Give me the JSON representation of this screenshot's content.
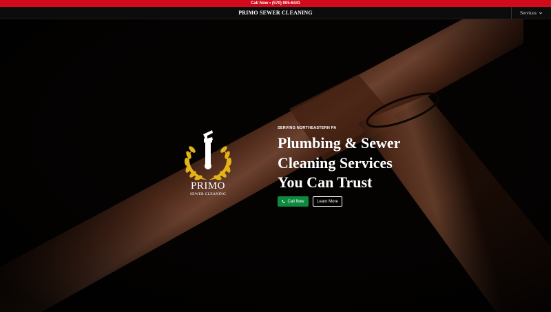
{
  "topbar": {
    "call_label": "Call Now • (570) 905-6441"
  },
  "nav": {
    "brand": "PRIMO SEWER CLEANING",
    "menu_label": "Services"
  },
  "logo": {
    "name": "PRIMO",
    "tagline": "SEWER CLEANING"
  },
  "hero": {
    "eyebrow": "SERVING NORTHEASTERN PA",
    "headline_lines": [
      "Plumbing & Sewer",
      "Cleaning Services",
      "You Can Trust"
    ],
    "call_button": "Call Now",
    "learn_button": "Learn More"
  },
  "colors": {
    "topbar_bg": "#d10a1c",
    "call_button_bg": "#0e8a3e",
    "logo_gold": "#e2b418",
    "pipe_copper": "#8a4e32"
  },
  "icons": {
    "menu": "chevron-down-icon",
    "call": "phone-icon",
    "logo": "wrench-laurel-icon"
  }
}
